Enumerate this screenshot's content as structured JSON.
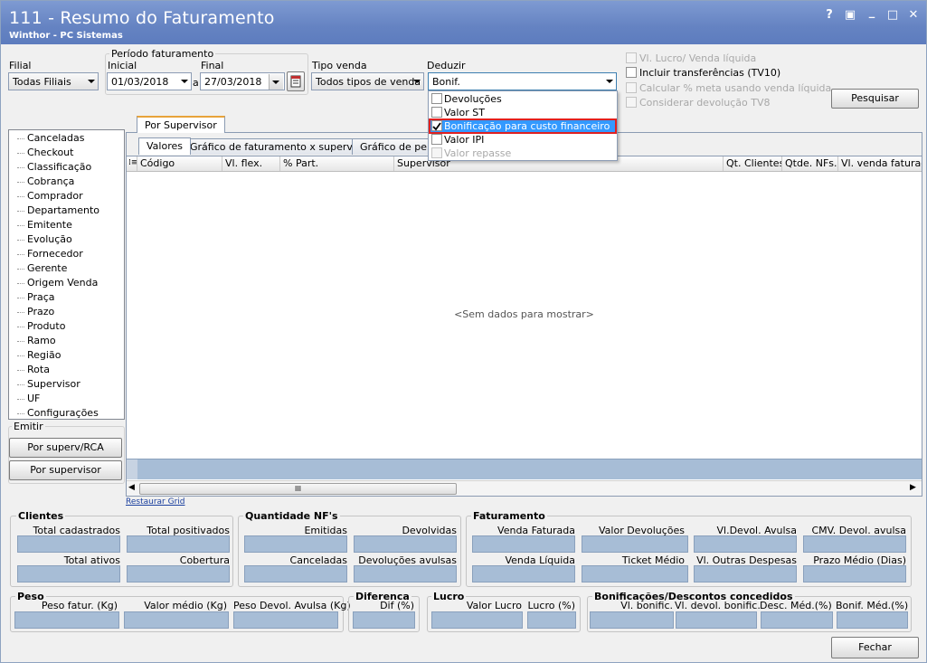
{
  "window": {
    "title": "111 - Resumo do Faturamento",
    "subtitle": "Winthor - PC Sistemas",
    "buttons": [
      "?",
      "▣",
      "_",
      "□",
      "✕"
    ]
  },
  "filters": {
    "filial_label": "Filial",
    "filial_value": "Todas Filiais",
    "periodo_label": "Período faturamento",
    "inicial_label": "Inicial",
    "inicial_value": "01/03/2018",
    "a_label": "a",
    "final_label": "Final",
    "final_value": "27/03/2018",
    "tipo_venda_label": "Tipo venda",
    "tipo_venda_value": "Todos tipos de venda",
    "deduzir_label": "Deduzir",
    "deduzir_value": "Bonif."
  },
  "deduzir_options": [
    {
      "label": "Devoluções",
      "checked": false,
      "disabled": false
    },
    {
      "label": "Valor ST",
      "checked": false,
      "disabled": false
    },
    {
      "label": "Bonificação para custo financeiro",
      "checked": true,
      "disabled": false
    },
    {
      "label": "Valor IPI",
      "checked": false,
      "disabled": false
    },
    {
      "label": "Valor repasse",
      "checked": false,
      "disabled": true
    }
  ],
  "options": {
    "vl_lucro": "Vl. Lucro/ Venda líquida",
    "incluir_transf": "Incluir transferências  (TV10)",
    "calcular_meta": "Calcular % meta usando venda líquida",
    "considerar_dev": "Considerar devolução TV8"
  },
  "pesquisar_label": "Pesquisar",
  "tree_items": [
    "Canceladas",
    "Checkout",
    "Classificação",
    "Cobrança",
    "Comprador",
    "Departamento",
    "Emitente",
    "Evolução",
    "Fornecedor",
    "Gerente",
    "Origem Venda",
    "Praça",
    "Prazo",
    "Produto",
    "Ramo",
    "Região",
    "Rota",
    "Supervisor",
    "UF",
    "Configurações"
  ],
  "emitir": {
    "label": "Emitir",
    "btn1": "Por superv/RCA",
    "btn2": "Por supervisor"
  },
  "main_tab": "Por Supervisor",
  "sub_tabs": [
    "Valores",
    "Gráfico de faturamento x supervisor",
    "Gráfico de perce"
  ],
  "columns": [
    "Código",
    "Vl. flex.",
    "% Part.",
    "Supervisor",
    "Qt. Clientes",
    "Qtde. NFs.",
    "Vl. venda faturada"
  ],
  "empty_text": "<Sem dados para mostrar>",
  "scroll_grip": "III",
  "restaurar_grid": "Restaurar Grid",
  "clientes": {
    "title": "Clientes",
    "f1": "Total cadastrados",
    "f2": "Total positivados",
    "f3": "Total ativos",
    "f4": "Cobertura"
  },
  "quantidade": {
    "title": "Quantidade NF's",
    "f1": "Emitidas",
    "f2": "Devolvidas",
    "f3": "Canceladas",
    "f4": "Devoluções avulsas"
  },
  "faturamento": {
    "title": "Faturamento",
    "f1": "Venda Faturada",
    "f2": "Valor Devoluções",
    "f3": "Vl.Devol. Avulsa",
    "f4": "CMV. Devol. avulsa",
    "f5": "Venda Líquida",
    "f6": "Ticket Médio",
    "f7": "Vl. Outras Despesas",
    "f8": "Prazo Médio (Dias)"
  },
  "peso": {
    "title": "Peso",
    "f1": "Peso fatur. (Kg)",
    "f2": "Valor médio (Kg)",
    "f3": "Peso Devol. Avulsa (Kg)"
  },
  "diferenca": {
    "title": "Diferenca",
    "f1": "Dif (%)"
  },
  "lucro": {
    "title": "Lucro",
    "f1": "Valor Lucro",
    "f2": "Lucro (%)"
  },
  "bonificacoes": {
    "title": "Bonificações/Descontos concedidos",
    "f1": "Vl. bonific.",
    "f2": "Vl. devol. bonific.",
    "f3": "Desc. Méd.(%)",
    "f4": "Bonif. Méd.(%)"
  },
  "fechar_label": "Fechar",
  "colors": {
    "title_bar": "#6583c2",
    "field": "#a7bdd6",
    "highlight": "#3399ff",
    "red_outline": "#e02020"
  }
}
